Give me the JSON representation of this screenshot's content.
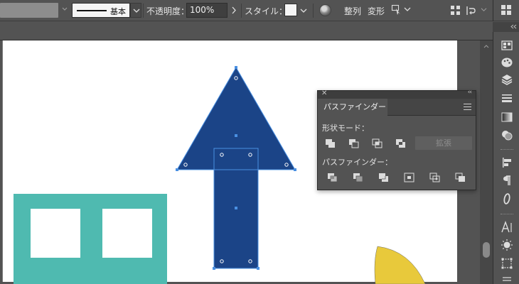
{
  "control_bar": {
    "stroke_profile": "基本",
    "opacity_label": "不透明度：",
    "opacity_value": "100%",
    "style_label": "スタイル：",
    "align_label": "整列",
    "transform_label": "変形"
  },
  "pathfinder": {
    "tab_label": "パスファインダー",
    "shape_modes_label": "形状モード：",
    "pathfinders_label": "パスファインダー：",
    "expand_label": "拡張",
    "shape_mode_buttons": [
      "unite-icon",
      "minus-front-icon",
      "intersect-icon",
      "exclude-icon"
    ],
    "pathfinder_buttons": [
      "divide-icon",
      "trim-icon",
      "merge-icon",
      "crop-icon",
      "outline-icon",
      "minus-back-icon"
    ]
  },
  "dock_icons": [
    "swatches-icon",
    "brushes-icon",
    "layers-icon",
    "stroke-icon",
    "gradient-icon",
    "transparency-icon",
    "align-icon",
    "paragraph-icon",
    "opentype-icon",
    "character-icon",
    "symbols-icon",
    "transform-icon",
    "more-icon"
  ],
  "colors": {
    "arrow": "#1b4487",
    "selection": "#4a90e2",
    "teal": "#4fbab0",
    "yellow": "#e8c93b",
    "panel_bg": "#535353",
    "artboard": "#ffffff"
  }
}
